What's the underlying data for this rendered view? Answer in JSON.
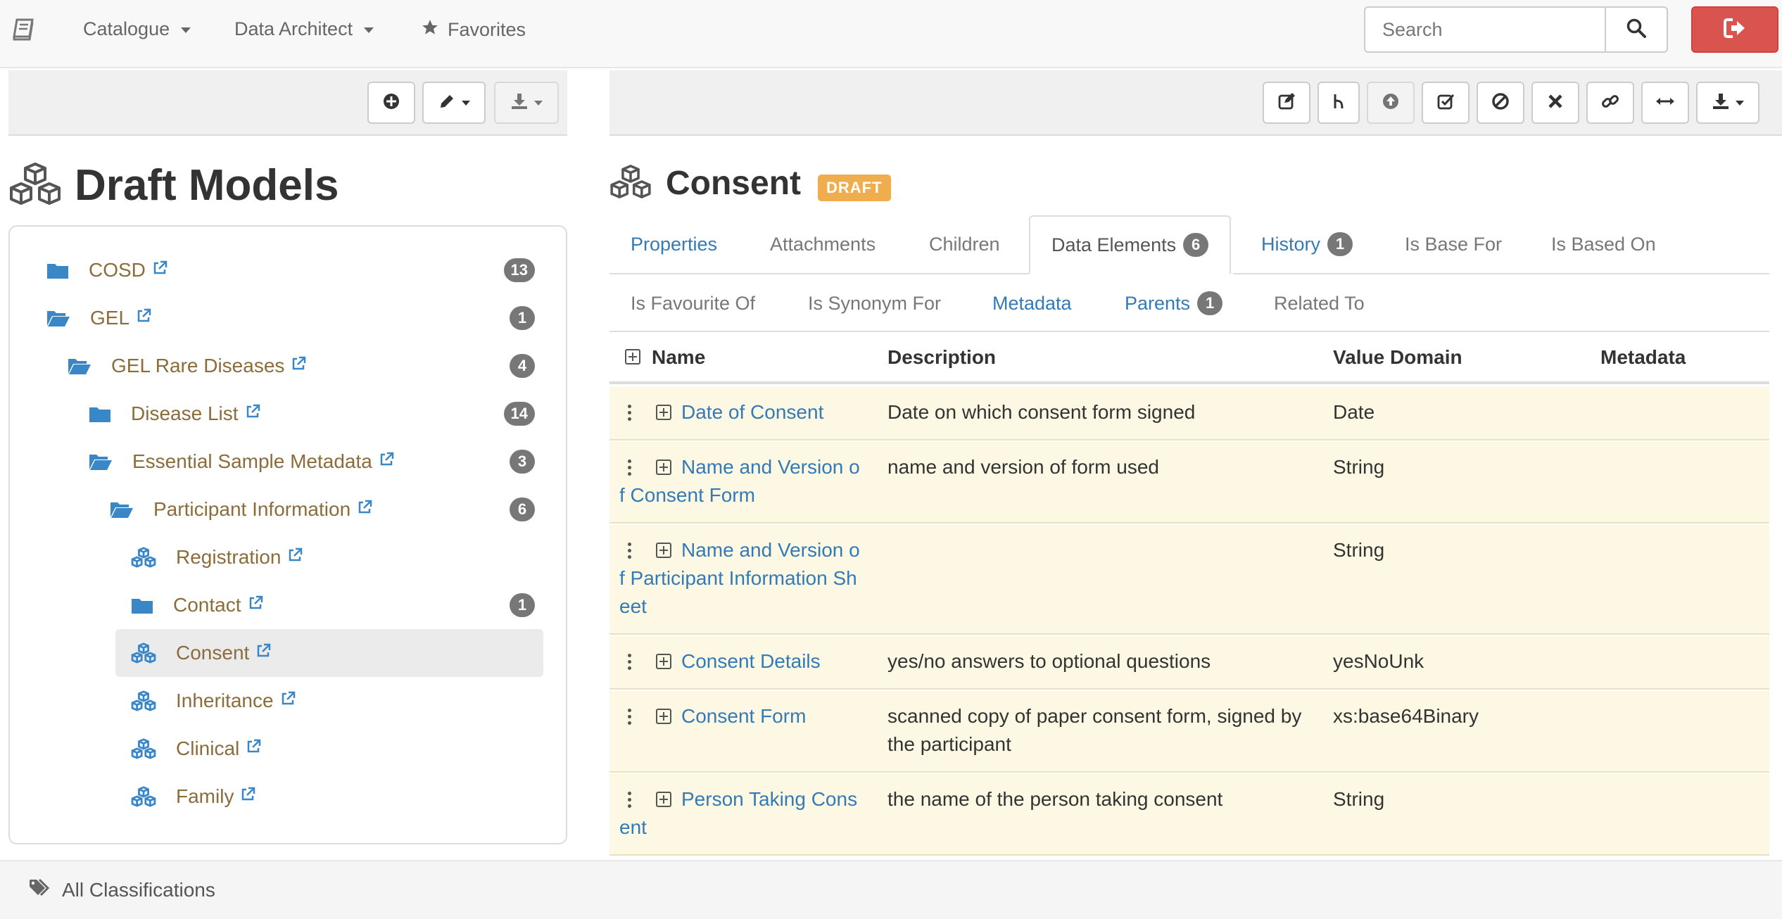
{
  "nav": {
    "catalogue": "Catalogue",
    "data_architect": "Data Architect",
    "favorites": "Favorites",
    "search_placeholder": "Search"
  },
  "left": {
    "title": "Draft Models",
    "tree": [
      {
        "label": "COSD",
        "count": "13",
        "icon": "folder-icon"
      },
      {
        "label": "GEL",
        "count": "1",
        "icon": "folder-open-icon"
      },
      {
        "label": "GEL Rare Diseases",
        "count": "4",
        "icon": "folder-open-icon"
      },
      {
        "label": "Disease List",
        "count": "14",
        "icon": "folder-icon"
      },
      {
        "label": "Essential Sample Metadata",
        "count": "3",
        "icon": "folder-open-icon"
      },
      {
        "label": "Participant Information",
        "count": "6",
        "icon": "folder-open-icon"
      },
      {
        "label": "Registration",
        "count": "",
        "icon": "cubes-icon"
      },
      {
        "label": "Contact",
        "count": "1",
        "icon": "folder-icon"
      },
      {
        "label": "Consent",
        "count": "",
        "icon": "cubes-icon",
        "selected": true
      },
      {
        "label": "Inheritance",
        "count": "",
        "icon": "cubes-icon"
      },
      {
        "label": "Clinical",
        "count": "",
        "icon": "cubes-icon"
      },
      {
        "label": "Family",
        "count": "",
        "icon": "cubes-icon"
      }
    ]
  },
  "bottom": {
    "classifications": "All Classifications"
  },
  "right": {
    "title": "Consent",
    "status": "DRAFT",
    "tabs_row1": [
      {
        "label": "Properties",
        "style": "link"
      },
      {
        "label": "Attachments",
        "style": "muted"
      },
      {
        "label": "Children",
        "style": "muted"
      },
      {
        "label": "Data Elements",
        "style": "active",
        "badge": "6"
      },
      {
        "label": "History",
        "style": "link",
        "badge": "1"
      },
      {
        "label": "Is Base For",
        "style": "muted"
      },
      {
        "label": "Is Based On",
        "style": "muted"
      }
    ],
    "tabs_row2": [
      {
        "label": "Is Favourite Of",
        "style": "muted"
      },
      {
        "label": "Is Synonym For",
        "style": "muted"
      },
      {
        "label": "Metadata",
        "style": "link"
      },
      {
        "label": "Parents",
        "style": "link",
        "badge": "1"
      },
      {
        "label": "Related To",
        "style": "muted"
      }
    ],
    "table": {
      "headers": [
        "Name",
        "Description",
        "Value Domain",
        "Metadata"
      ],
      "rows": [
        {
          "name": [
            "Date of Consent"
          ],
          "description": [
            "Date on which consent form signed"
          ],
          "value_domain": "Date"
        },
        {
          "name": [
            "Name and Version o",
            "f Consent Form"
          ],
          "description": [
            "name and version of form used"
          ],
          "value_domain": "String"
        },
        {
          "name": [
            "Name and Version o",
            "f Participant Information Sh",
            "eet"
          ],
          "description": [
            ""
          ],
          "value_domain": "String"
        },
        {
          "name": [
            "Consent Details"
          ],
          "description": [
            "yes/no answers to optional questions"
          ],
          "value_domain": "yesNoUnk"
        },
        {
          "name": [
            "Consent Form"
          ],
          "description": [
            "scanned copy of paper consent form, signed by",
            "the participant"
          ],
          "value_domain": "xs:base64Binary"
        },
        {
          "name": [
            "Person Taking Cons",
            "ent"
          ],
          "description": [
            "the name of the person taking consent"
          ],
          "value_domain": "String"
        }
      ]
    }
  }
}
